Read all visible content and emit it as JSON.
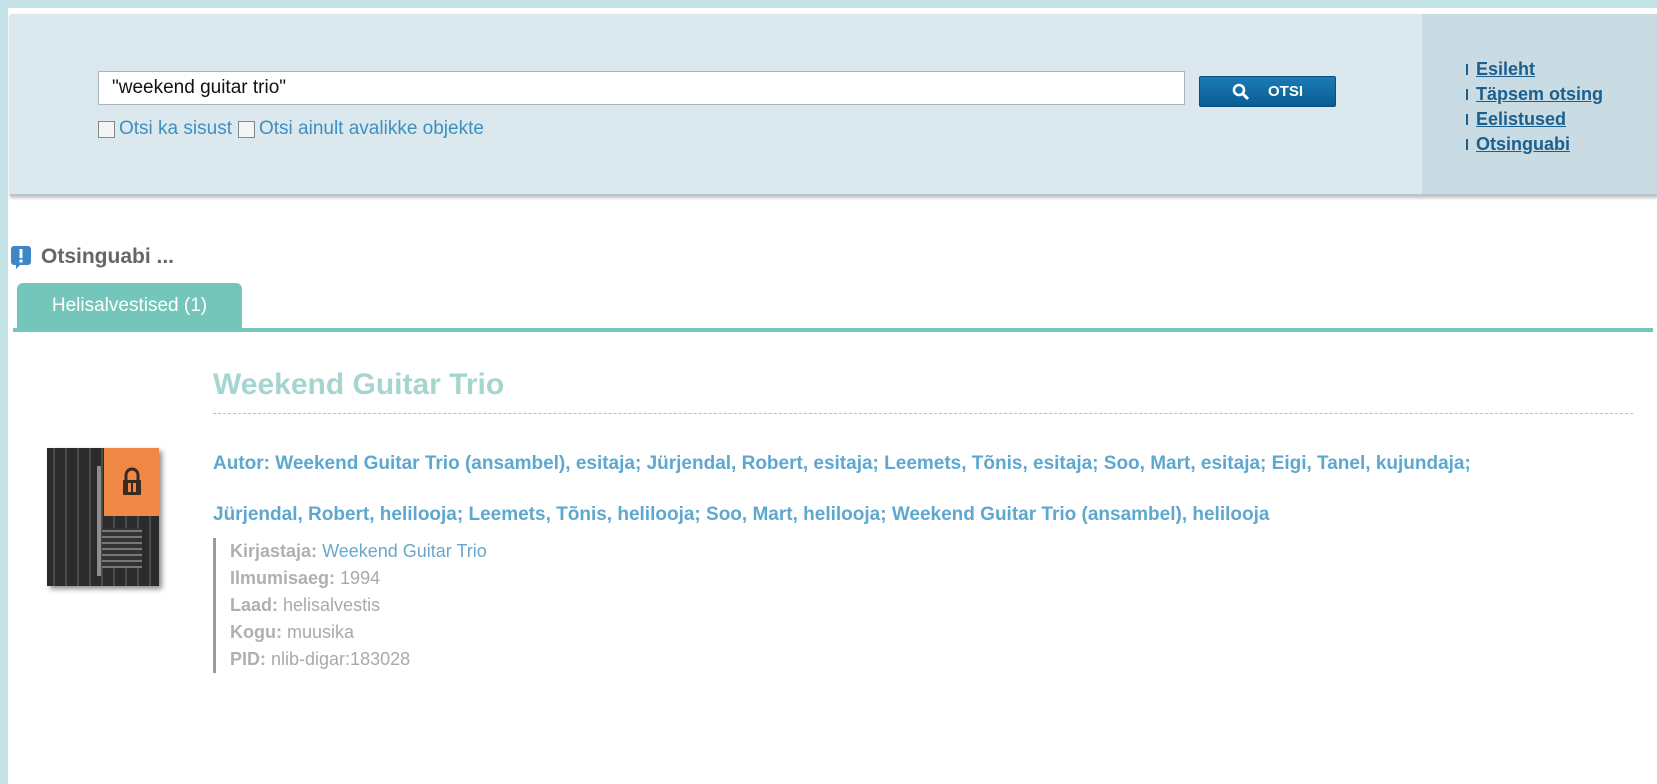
{
  "search": {
    "query": "\"weekend guitar trio\"",
    "button_label": "OTSI",
    "option_content": "Otsi ka sisust",
    "option_public": "Otsi ainult avalikke objekte"
  },
  "side_nav": {
    "items": [
      {
        "label": "Esileht"
      },
      {
        "label": "Täpsem otsing"
      },
      {
        "label": "Eelistused"
      },
      {
        "label": "Otsinguabi"
      }
    ]
  },
  "help": {
    "label": "Otsinguabi ..."
  },
  "tabs": [
    {
      "label": "Helisalvestised (1)"
    }
  ],
  "result": {
    "title": "Weekend Guitar Trio",
    "authors_line1": "Autor: Weekend Guitar Trio (ansambel), esitaja; Jürjendal, Robert, esitaja; Leemets, Tõnis, esitaja; Soo, Mart, esitaja; Eigi, Tanel, kujundaja;",
    "authors_line2": "Jürjendal, Robert, helilooja; Leemets, Tõnis, helilooja; Soo, Mart, helilooja; Weekend Guitar Trio (ansambel), helilooja",
    "meta": {
      "publisher_label": "Kirjastaja:",
      "publisher_value": "Weekend Guitar Trio",
      "date_label": "Ilmumisaeg:",
      "date_value": "1994",
      "type_label": "Laad:",
      "type_value": "helisalvestis",
      "collection_label": "Kogu:",
      "collection_value": "muusika",
      "pid_label": "PID:",
      "pid_value": "nlib-digar:183028"
    }
  },
  "colors": {
    "accent_teal": "#73c6b9",
    "button_blue": "#0b5e93",
    "link_blue": "#1b5f8e",
    "lock_orange": "#ef8847"
  }
}
